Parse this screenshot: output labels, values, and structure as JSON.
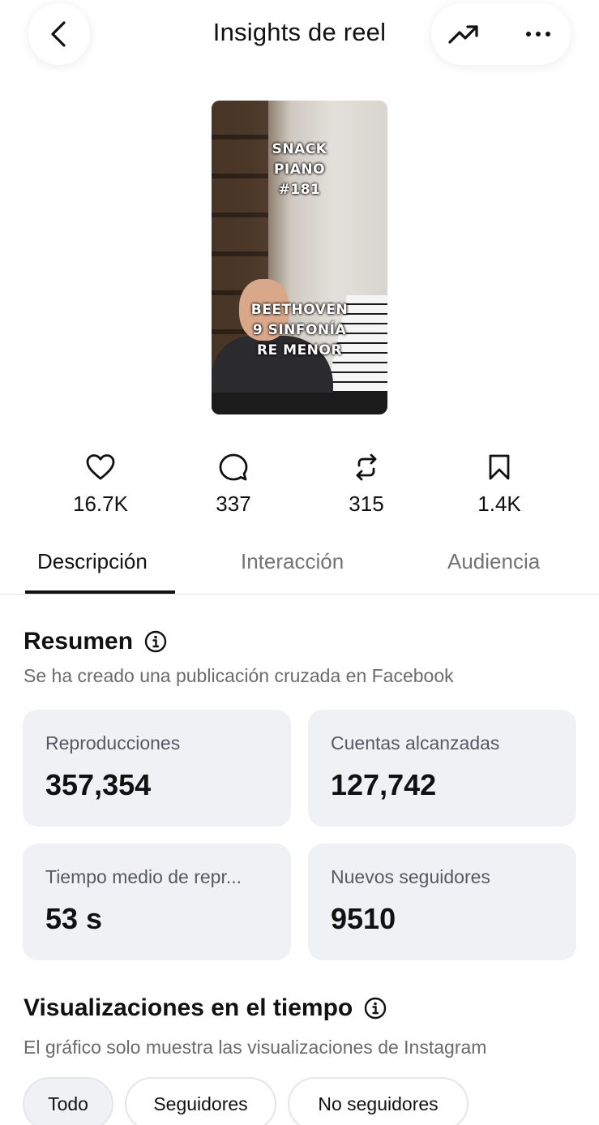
{
  "header": {
    "title": "Insights de reel",
    "back_icon": "chevron-left-icon",
    "trend_icon": "trending-up-icon",
    "more_icon": "more-horizontal-icon"
  },
  "thumbnail": {
    "caption_top": [
      "SNACK",
      "PIANO",
      "#181"
    ],
    "caption_bottom": [
      "BEETHOVEN",
      "9 SINFONÍA",
      "RE MENOR"
    ]
  },
  "stats": [
    {
      "icon": "heart-icon",
      "value": "16.7K"
    },
    {
      "icon": "comment-icon",
      "value": "337"
    },
    {
      "icon": "repost-icon",
      "value": "315"
    },
    {
      "icon": "bookmark-icon",
      "value": "1.4K"
    }
  ],
  "tabs": [
    {
      "label": "Descripción",
      "active": true
    },
    {
      "label": "Interacción",
      "active": false
    },
    {
      "label": "Audiencia",
      "active": false
    }
  ],
  "summary": {
    "title": "Resumen",
    "subtitle": "Se ha creado una publicación cruzada en Facebook",
    "cards": [
      {
        "label": "Reproducciones",
        "value": "357,354"
      },
      {
        "label": "Cuentas alcanzadas",
        "value": "127,742"
      },
      {
        "label": "Tiempo medio de repr...",
        "value": "53 s"
      },
      {
        "label": "Nuevos seguidores",
        "value": "9510"
      }
    ]
  },
  "views_over_time": {
    "title": "Visualizaciones en el tiempo",
    "subtitle": "El gráfico solo muestra las visualizaciones de Instagram",
    "filters": [
      {
        "label": "Todo",
        "selected": true
      },
      {
        "label": "Seguidores",
        "selected": false
      },
      {
        "label": "No seguidores",
        "selected": false
      }
    ]
  }
}
